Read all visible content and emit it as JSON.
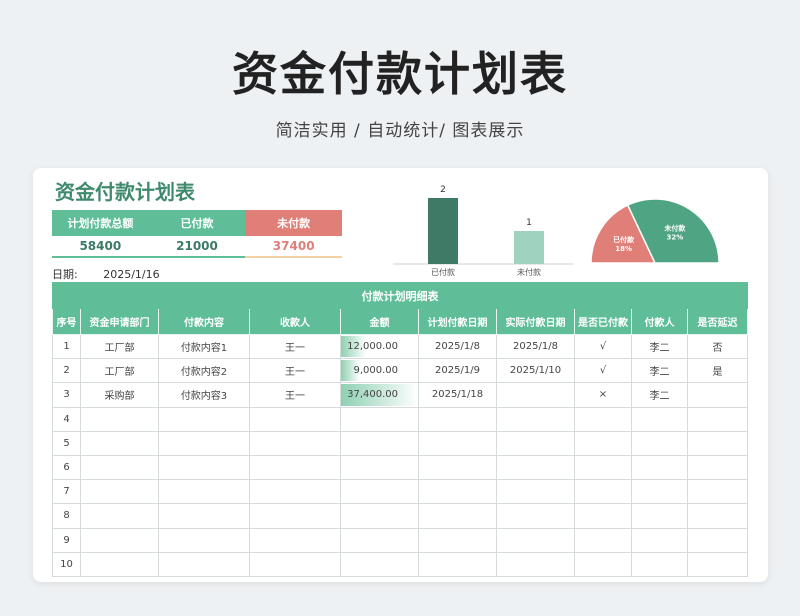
{
  "hero": {
    "title": "资金付款计划表",
    "subtitle": "简洁实用 / 自动统计/ 图表展示"
  },
  "sheet": {
    "title": "资金付款计划表",
    "summary": {
      "headers": [
        "计划付款总额",
        "已付款",
        "未付款"
      ],
      "values": [
        "58400",
        "21000",
        "37400"
      ]
    },
    "date_label": "日期:",
    "date_value": "2025/1/16"
  },
  "chart_data": [
    {
      "type": "bar",
      "categories": [
        "已付款",
        "未付款"
      ],
      "values": [
        2,
        1
      ],
      "data_labels": [
        "2",
        "1"
      ],
      "ylim": [
        0,
        2
      ],
      "colors": [
        "#3f7a66",
        "#9fd3bf"
      ]
    },
    {
      "type": "pie",
      "style": "half-donut",
      "labels": [
        "已付款",
        "未付款"
      ],
      "values": [
        18,
        32
      ],
      "percent_labels": [
        "18%",
        "32%"
      ],
      "colors": [
        "#e07f78",
        "#4fa583"
      ]
    }
  ],
  "table": {
    "caption": "付款计划明细表",
    "columns": [
      "序号",
      "资金申请部门",
      "付款内容",
      "收款人",
      "金额",
      "计划付款日期",
      "实际付款日期",
      "是否已付款",
      "付款人",
      "是否延迟"
    ],
    "amount_max": 37400,
    "rows": [
      {
        "no": "1",
        "dept": "工厂部",
        "content": "付款内容1",
        "payee": "王一",
        "amount": "12,000.00",
        "amount_value": 12000,
        "plan_date": "2025/1/8",
        "actual_date": "2025/1/8",
        "paid": "√",
        "payer": "李二",
        "delayed": "否"
      },
      {
        "no": "2",
        "dept": "工厂部",
        "content": "付款内容2",
        "payee": "王一",
        "amount": "9,000.00",
        "amount_value": 9000,
        "plan_date": "2025/1/9",
        "actual_date": "2025/1/10",
        "paid": "√",
        "payer": "李二",
        "delayed": "是"
      },
      {
        "no": "3",
        "dept": "采购部",
        "content": "付款内容3",
        "payee": "王一",
        "amount": "37,400.00",
        "amount_value": 37400,
        "plan_date": "2025/1/18",
        "actual_date": "",
        "paid": "×",
        "payer": "李二",
        "delayed": ""
      },
      {
        "no": "4",
        "dept": "",
        "content": "",
        "payee": "",
        "amount": "",
        "amount_value": 0,
        "plan_date": "",
        "actual_date": "",
        "paid": "",
        "payer": "",
        "delayed": ""
      },
      {
        "no": "5",
        "dept": "",
        "content": "",
        "payee": "",
        "amount": "",
        "amount_value": 0,
        "plan_date": "",
        "actual_date": "",
        "paid": "",
        "payer": "",
        "delayed": ""
      },
      {
        "no": "6",
        "dept": "",
        "content": "",
        "payee": "",
        "amount": "",
        "amount_value": 0,
        "plan_date": "",
        "actual_date": "",
        "paid": "",
        "payer": "",
        "delayed": ""
      },
      {
        "no": "7",
        "dept": "",
        "content": "",
        "payee": "",
        "amount": "",
        "amount_value": 0,
        "plan_date": "",
        "actual_date": "",
        "paid": "",
        "payer": "",
        "delayed": ""
      },
      {
        "no": "8",
        "dept": "",
        "content": "",
        "payee": "",
        "amount": "",
        "amount_value": 0,
        "plan_date": "",
        "actual_date": "",
        "paid": "",
        "payer": "",
        "delayed": ""
      },
      {
        "no": "9",
        "dept": "",
        "content": "",
        "payee": "",
        "amount": "",
        "amount_value": 0,
        "plan_date": "",
        "actual_date": "",
        "paid": "",
        "payer": "",
        "delayed": ""
      },
      {
        "no": "10",
        "dept": "",
        "content": "",
        "payee": "",
        "amount": "",
        "amount_value": 0,
        "plan_date": "",
        "actual_date": "",
        "paid": "",
        "payer": "",
        "delayed": ""
      }
    ]
  }
}
